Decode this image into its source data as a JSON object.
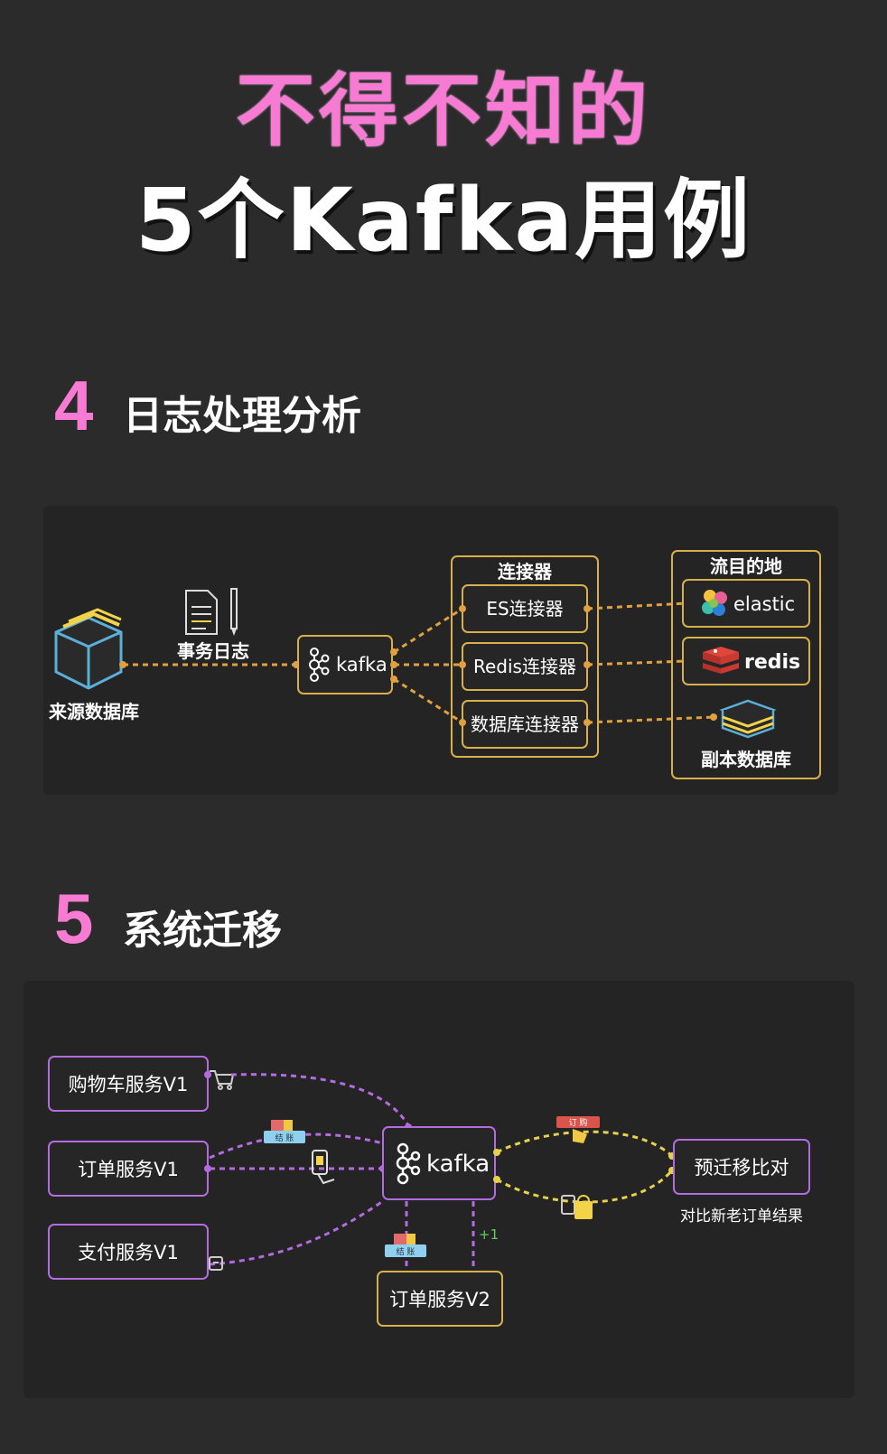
{
  "title": {
    "line1": "不得不知的",
    "line2": "5个Kafka用例"
  },
  "section4": {
    "number": "4",
    "title": "日志处理分析",
    "source_label": "来源数据库",
    "log_label": "事务日志",
    "kafka_label": "kafka",
    "connectors_title": "连接器",
    "connectors": [
      "ES连接器",
      "Redis连接器",
      "数据库连接器"
    ],
    "dest_title": "流目的地",
    "dest_elastic": "elastic",
    "dest_redis": "redis",
    "dest_replica": "副本数据库"
  },
  "section5": {
    "number": "5",
    "title": "系统迁移",
    "services_v1": [
      "购物车服务V1",
      "订单服务V1",
      "支付服务V1"
    ],
    "kafka_label": "kafka",
    "order_v2": "订单服务V2",
    "compare_label": "预迁移比对",
    "compare_caption": "对比新老订单结果",
    "plus_one": "+1",
    "tag_checkout": "结 账",
    "tag_order": "订 购"
  },
  "colors": {
    "pink": "#f77bd3",
    "orange": "#e0a040",
    "gold_border": "#d8b04a",
    "purple": "#b36be0",
    "yellow_dash": "#e5d24a"
  }
}
